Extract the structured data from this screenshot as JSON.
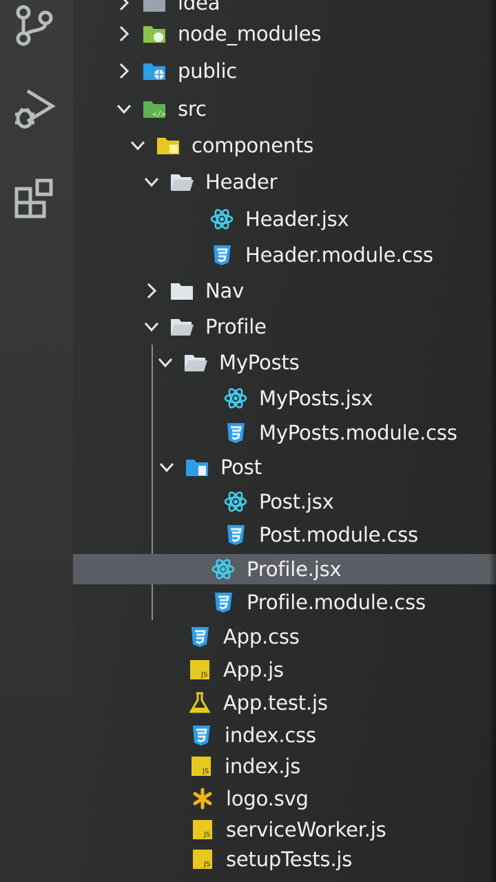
{
  "activity_bar": {
    "icons": [
      "source-control-icon",
      "run-debug-icon",
      "extensions-icon"
    ]
  },
  "colors": {
    "background": "#2c2e2e",
    "selected_row": "#5a5d63",
    "text": "#f1f1f1",
    "react_icon": "#3fd0f0",
    "css_icon": "#2f9ce8",
    "js_icon": "#e8c820",
    "folder_icon": "#dfe5ea"
  },
  "explorer": {
    "items": [
      {
        "label": "idea",
        "icon": "idea-folder-icon",
        "chevron": "right"
      },
      {
        "label": "node_modules",
        "icon": "node-folder-icon",
        "chevron": "right"
      },
      {
        "label": "public",
        "icon": "public-folder-icon",
        "chevron": "right"
      },
      {
        "label": "src",
        "icon": "src-folder-icon",
        "chevron": "down"
      },
      {
        "label": "components",
        "icon": "components-folder-icon",
        "chevron": "down"
      },
      {
        "label": "Header",
        "icon": "folder-open-icon",
        "chevron": "down"
      },
      {
        "label": "Header.jsx",
        "icon": "react-icon"
      },
      {
        "label": "Header.module.css",
        "icon": "css-icon"
      },
      {
        "label": "Nav",
        "icon": "folder-icon",
        "chevron": "right"
      },
      {
        "label": "Profile",
        "icon": "folder-open-icon",
        "chevron": "down"
      },
      {
        "label": "MyPosts",
        "icon": "folder-open-icon",
        "chevron": "down"
      },
      {
        "label": "MyPosts.jsx",
        "icon": "react-icon"
      },
      {
        "label": "MyPosts.module.css",
        "icon": "css-icon"
      },
      {
        "label": "Post",
        "icon": "post-folder-icon",
        "chevron": "down"
      },
      {
        "label": "Post.jsx",
        "icon": "react-icon"
      },
      {
        "label": "Post.module.css",
        "icon": "css-icon"
      },
      {
        "label": "Profile.jsx",
        "icon": "react-icon",
        "selected": true
      },
      {
        "label": "Profile.module.css",
        "icon": "css-icon"
      },
      {
        "label": "App.css",
        "icon": "css-icon"
      },
      {
        "label": "App.js",
        "icon": "js-icon"
      },
      {
        "label": "App.test.js",
        "icon": "test-flask-icon"
      },
      {
        "label": "index.css",
        "icon": "css-icon"
      },
      {
        "label": "index.js",
        "icon": "js-icon"
      },
      {
        "label": "logo.svg",
        "icon": "svg-asterisk-icon"
      },
      {
        "label": "serviceWorker.js",
        "icon": "js-icon"
      },
      {
        "label": "setupTests.js",
        "icon": "js-icon"
      }
    ]
  }
}
